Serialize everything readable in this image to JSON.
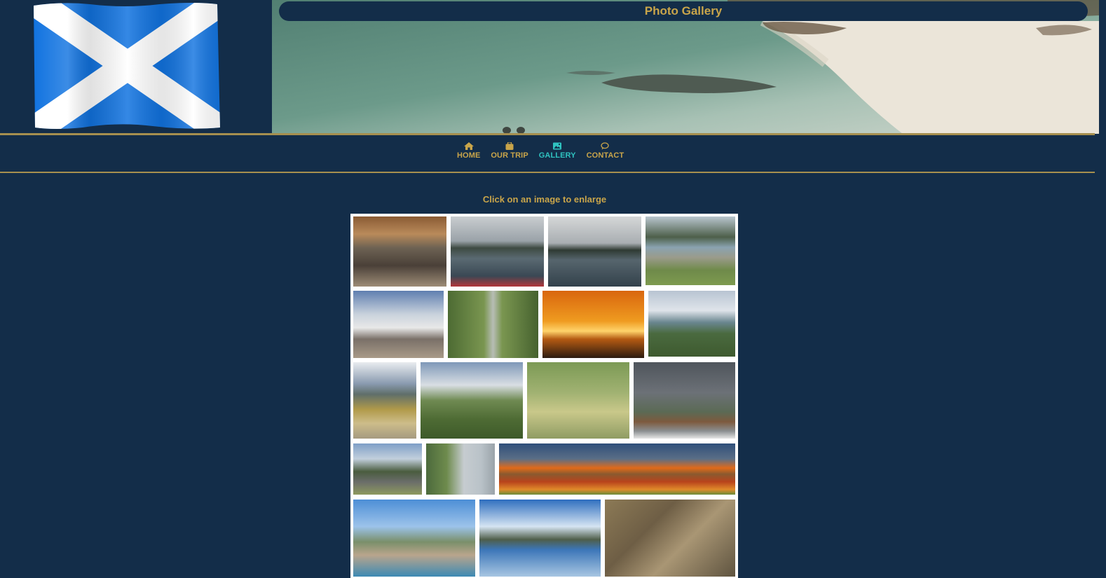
{
  "header": {
    "title": "Photo Gallery"
  },
  "nav": {
    "items": [
      {
        "label": "HOME",
        "icon": "home-icon",
        "active": false
      },
      {
        "label": "OUR TRIP",
        "icon": "suitcase-icon",
        "active": false
      },
      {
        "label": "GALLERY",
        "icon": "image-icon",
        "active": true
      },
      {
        "label": "CONTACT",
        "icon": "chat-bubble-icon",
        "active": false
      }
    ]
  },
  "gallery": {
    "instruction": "Click on an image to enlarge"
  },
  "colors": {
    "background": "#132d49",
    "accent_gold": "#c9a54a",
    "active_teal": "#2fc2c0",
    "rule": "#a68f4f"
  }
}
